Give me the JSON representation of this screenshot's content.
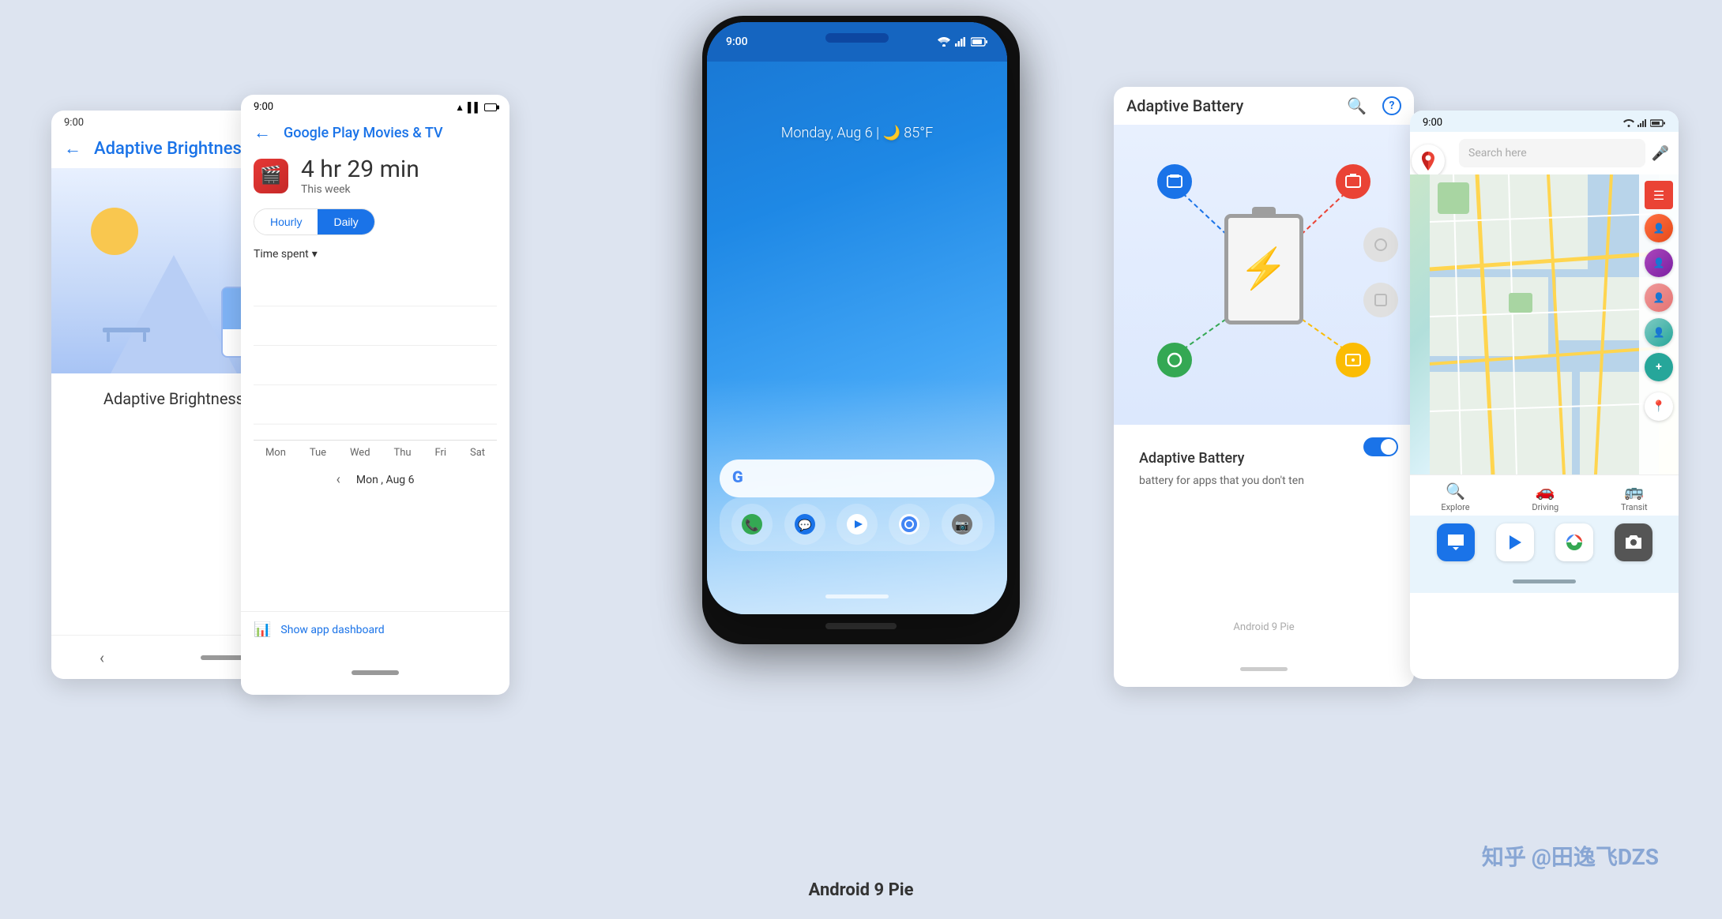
{
  "page": {
    "background": "#dde4f0",
    "caption": "Android 9 Pie",
    "watermark": "知乎 @田逸飞DZS"
  },
  "adaptive_brightness": {
    "status_time": "9:00",
    "back_arrow": "←",
    "title": "Adaptive Brightness",
    "bottom_title": "Adaptive Brightness"
  },
  "digital_wellbeing": {
    "status_time": "9:00",
    "back_arrow": "←",
    "app_title": "Google Play Movies & TV",
    "time_value": "4 hr 29 min",
    "time_label": "This week",
    "tab_hourly": "Hourly",
    "tab_daily": "Daily",
    "dropdown_label": "Time spent",
    "days": [
      "Mon",
      "Tue",
      "Wed",
      "Thu",
      "Fri",
      "Sat"
    ],
    "nav_date": "Mon , Aug 6",
    "nav_prev": "‹",
    "show_dashboard": "Show app dashboard"
  },
  "center_phone": {
    "status_time": "9:00",
    "date_weather": "Monday, Aug 6  |  🌙  85°F",
    "search_placeholder": "Google",
    "dock_icons": [
      "📞",
      "💬",
      "▶",
      "🔴",
      "📷"
    ],
    "home_indicator": true
  },
  "adaptive_battery": {
    "title": "Adaptive Battery",
    "search_icon": "🔍",
    "help_icon": "?",
    "toggle_on": true,
    "adaptive_title": "Adaptive Battery",
    "adaptive_desc": "battery for apps that you don't\nten",
    "version_label": "Android 9 Pie"
  },
  "google_maps": {
    "status_time": "9:00",
    "search_placeholder": "Search here",
    "nav_items": [
      "Explore",
      "Driving",
      "Transit"
    ],
    "dock_icons": [
      "💬",
      "▶",
      "🔴",
      "📷"
    ]
  }
}
